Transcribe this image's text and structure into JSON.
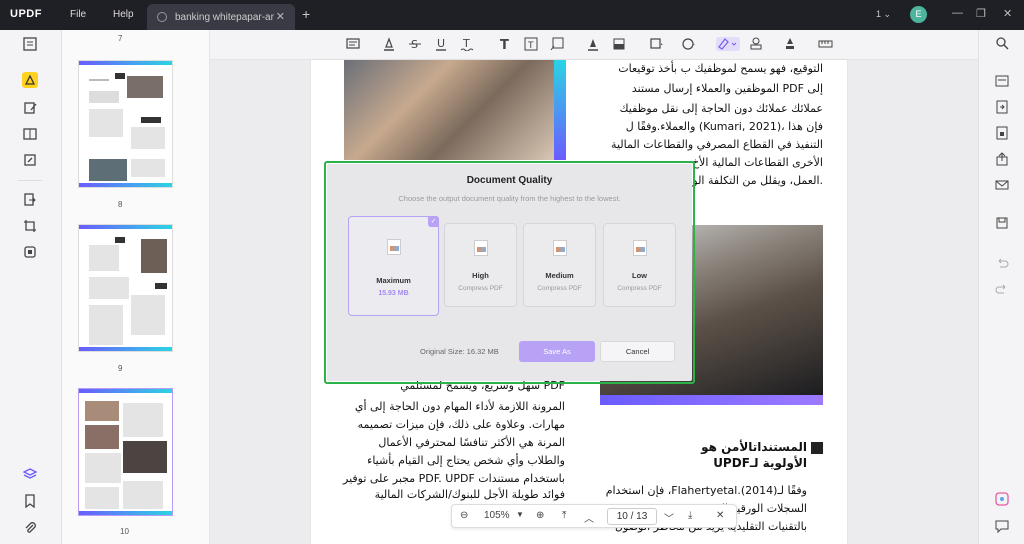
{
  "app": {
    "logo": "UPDF"
  },
  "menu": {
    "file": "File",
    "help": "Help"
  },
  "tab": {
    "title": "banking whitepapar-ar"
  },
  "titlebar": {
    "page_indicator": "1",
    "avatar_letter": "E"
  },
  "thumbnails": [
    {
      "number": "7"
    },
    {
      "number": "8"
    },
    {
      "number": "9"
    },
    {
      "number": "10"
    }
  ],
  "document": {
    "top_right_lines": [
      "التوقيع، فهو يسمح لموظفيك ب بأخذ توقيعات",
      "إلى PDF الموظفين والعملاء إرسال مستند",
      "عملائك عملائك دون الحاجة إلى نقل موظفيك",
      "فإن هذا ،(Kumari, 2021) والعملاء.وفقًا ل",
      "التنفيذ في القطاع المصرفي والقطاعات المالية",
      "الأخرى القطاعات المالية الأخ",
      ".العمل، ويقلل من التكلفة الور"
    ],
    "bottom_left_lines": [
      "PDF سهل وسريع، ويسمح لمستلمي",
      "المرونة اللازمة لأداء المهام دون الحاجة إلى أي",
      "مهارات. وعلاوة على ذلك، فإن ميزات تصميمه",
      "المرنة هي الأكثر تنافسًا لمحترفي الأعمال",
      "والطلاب وأي شخص يحتاج إلى القيام بأشياء",
      "باستخدام مستندات PDF. UPDF مجبر على توفير",
      "فوائد طويلة الأجل للبنوك/الشركات المالية"
    ],
    "heading_lines": [
      "المستنداتالأمن هو",
      "الأولوية لـUPDF"
    ],
    "bottom_right_lines": [
      "وفقًا لـFlahertyetal.(2014)، فإن استخدام",
      "السجلات الورقية الـ",
      "بالتقنيات التقليدية يزيد من مخاطر الوصول"
    ]
  },
  "navigation": {
    "zoom": "105%",
    "current_page": "10",
    "separator": "/",
    "total_pages": "13"
  },
  "dialog": {
    "title": "Document Quality",
    "subtitle": "Choose the output document quality from the highest to the lowest.",
    "options": [
      {
        "name": "Maximum",
        "detail": "15.93 MB",
        "selected": true
      },
      {
        "name": "High",
        "detail": "Compress PDF"
      },
      {
        "name": "Medium",
        "detail": "Compress PDF"
      },
      {
        "name": "Low",
        "detail": "Compress PDF"
      }
    ],
    "original_size": "Original Size: 16.32 MB",
    "save_label": "Save As",
    "cancel_label": "Cancel"
  },
  "colors": {
    "accent": "#b7a2f5",
    "highlight_border": "#2bb34a",
    "titlebar": "#1f1f26"
  }
}
